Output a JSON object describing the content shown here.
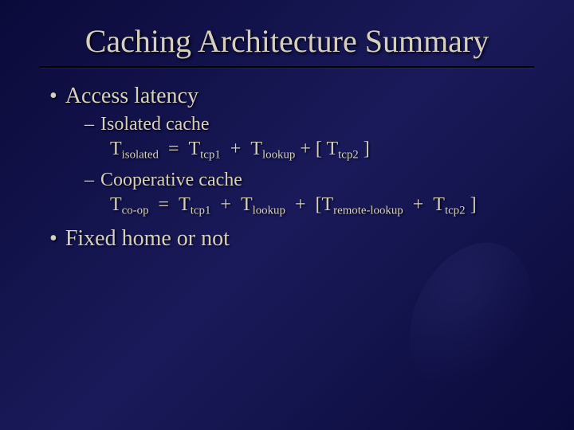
{
  "title": "Caching Architecture Summary",
  "bullets": {
    "b1a": "Access latency",
    "b2a": "Isolated cache",
    "b2b": "Cooperative cache",
    "b1b": "Fixed home or not"
  },
  "f1": {
    "t1": "T",
    "s1": "isolated",
    "eq": "  =  ",
    "t2": "T",
    "s2": "tcp1",
    "p1": "  +  ",
    "t3": "T",
    "s3": "lookup",
    "p2": " + [ ",
    "t4": "T",
    "s4": "tcp2",
    "cl": " ]"
  },
  "f2": {
    "t1": "T",
    "s1": "co-op",
    "eq": "  =  ",
    "t2": "T",
    "s2": "tcp1",
    "p1": "  +  ",
    "t3": "T",
    "s3": "lookup",
    "p2": "  +  [",
    "t4": "T",
    "s4": "remote-lookup",
    "p3": "  +  ",
    "t5": "T",
    "s5": "tcp2",
    "cl": " ]"
  }
}
